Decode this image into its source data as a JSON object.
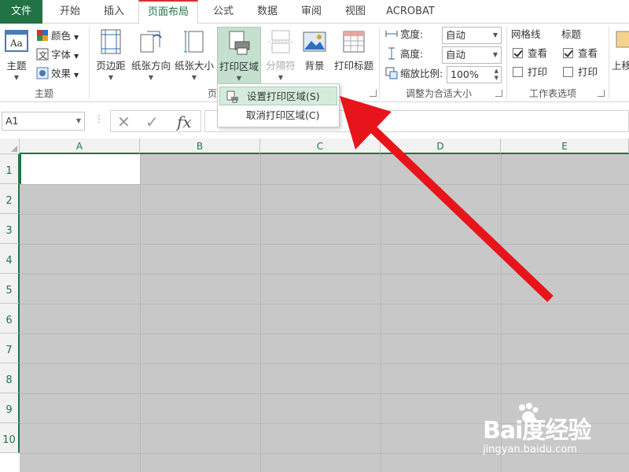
{
  "tabs": [
    {
      "label": "文件"
    },
    {
      "label": "开始"
    },
    {
      "label": "插入"
    },
    {
      "label": "页面布局"
    },
    {
      "label": "公式"
    },
    {
      "label": "数据"
    },
    {
      "label": "审阅"
    },
    {
      "label": "视图"
    },
    {
      "label": "ACROBAT"
    }
  ],
  "theme_group": {
    "theme_label": "主题",
    "color_label": "颜色",
    "font_label": "字体",
    "effect_label": "效果",
    "group_label": "主题"
  },
  "page_setup": {
    "margins_label": "页边距",
    "orientation_label": "纸张方向",
    "size_label": "纸张大小",
    "print_area_label": "打印区域",
    "breaks_label": "分隔符",
    "background_label": "背景",
    "print_titles_label": "打印标题",
    "group_label_partial": "页"
  },
  "scale": {
    "width_label": "宽度:",
    "width_value": "自动",
    "height_label": "高度:",
    "height_value": "自动",
    "zoom_label": "缩放比例:",
    "zoom_value": "100%",
    "group_label": "调整为合适大小"
  },
  "sheet_options": {
    "gridlines_label": "网格线",
    "gridlines_view": "查看",
    "gridlines_print": "打印",
    "headings_label": "标题",
    "headings_view": "查看",
    "headings_print": "打印",
    "group_label": "工作表选项"
  },
  "arrange": {
    "partial_label": "上移"
  },
  "dropdown": {
    "set_print_area": "设置打印区域(S)",
    "clear_print_area": "取消打印区域(C)"
  },
  "formula_bar": {
    "name_box": "A1",
    "fx": "fx"
  },
  "columns": [
    "A",
    "B",
    "C",
    "D",
    "E"
  ],
  "rows": [
    "1",
    "2",
    "3",
    "4",
    "5",
    "6",
    "7",
    "8",
    "9",
    "10"
  ],
  "watermark": {
    "logo": "Bai度经验",
    "url": "jingyan.baidu.com"
  },
  "colors": {
    "excel_green": "#217346",
    "arrow_red": "#e8141b",
    "print_area_gray": "#c8c8c8"
  }
}
